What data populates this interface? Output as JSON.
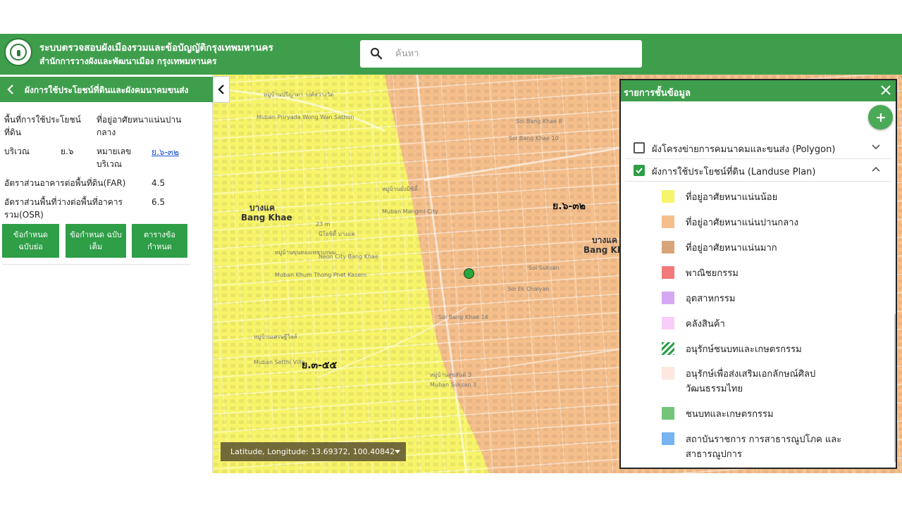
{
  "header": {
    "title": "ระบบตรวจสอบผังเมืองรวมและข้อบัญญัติกรุงเทพมหานคร",
    "subtitle": "สำนักการวางผังและพัฒนาเมือง กรุงเทพมหานคร",
    "search_placeholder": "ค้นหา",
    "search_value": "",
    "brand_color": "#3e9e4c"
  },
  "left_panel": {
    "title": "ผังการใช้ประโยชน์ที่ดินและผังคมนาคมขนส่ง",
    "rows": [
      {
        "label": "พื้นที่การใช้ประโยชน์ที่ดิน",
        "value": "ที่อยู่อาศัยหนาแน่นปานกลาง"
      },
      {
        "label": "บริเวณ",
        "value": "ย.๖",
        "sublabel": "หมายเลขบริเวณ",
        "link": "ย.๖-๓๒"
      },
      {
        "label": "อัตราส่วนอาคารต่อพื้นที่ดิน(FAR)",
        "value": "4.5"
      },
      {
        "label": "อัตราส่วนพื้นที่ว่างต่อพื้นที่อาคารรวม(OSR)",
        "value": "6.5"
      }
    ],
    "buttons": [
      "ข้อกำหนด ฉบับย่อ",
      "ข้อกำหนด ฉบับเต็ม",
      "ตารางข้อ กำหนด"
    ]
  },
  "map": {
    "zone_labels": [
      "ย.๖-๓๒",
      "ย.๓-๕๕"
    ],
    "district_labels": [
      "บางแค",
      "Bang Khae",
      "บางแค",
      "Bang Kh"
    ],
    "place_labels": [
      "หมู่บ้านปรีญาดา วงศ์สว่างวัด",
      "Muban Priryada Wong Wan Sathon",
      "หมู่บ้านมิตรไทย",
      "Mitraphap Si",
      "หมู่บ้านมั่งมีซิตี้",
      "Muban Mangmi City",
      "นีโอซิตี้ บางแค",
      "Neon City Bang Khae",
      "หมู่บ้านขุนทองเพชรเกษม",
      "Muban Khum Thong Phet Kasem",
      "หมู่บ้านเศรษฐีวิลล์",
      "Muban Setthi Ville",
      "หมู่บ้านสุขสันต์ 3",
      "Muban Suksan 3",
      "Soi Bang Khae 10",
      "Soi Bang Khae 8",
      "Soi Bang Khae 14",
      "Soi Ek Chaiyan",
      "Soi Suksan",
      "23 m"
    ],
    "coordinates_text": "Latitude, Longitude: 13.69372, 100.40842",
    "colors": {
      "low_density": "#f7f46a",
      "medium_density": "#f5bf8c",
      "marker": "#27a83b"
    }
  },
  "layers_panel": {
    "title": "รายการชั้นข้อมูล",
    "layers": [
      {
        "label": "ผังโครงข่ายการคมนาคมและขนส่ง (Polygon)",
        "checked": false,
        "expanded": false
      },
      {
        "label": "ผังการใช้ประโยชน์ที่ดิน (Landuse Plan)",
        "checked": true,
        "expanded": true
      }
    ],
    "legend": [
      {
        "label": "ที่อยู่อาศัยหนาแน่นน้อย",
        "color": "#f7f46a"
      },
      {
        "label": "ที่อยู่อาศัยหนาแน่นปานกลาง",
        "color": "#f5bf8c"
      },
      {
        "label": "ที่อยู่อาศัยหนาแน่นมาก",
        "color": "#d8a57b"
      },
      {
        "label": "พาณิชยกรรม",
        "color": "#f27a7a"
      },
      {
        "label": "อุตสาหกรรม",
        "color": "#d6a8f3"
      },
      {
        "label": "คลังสินค้า",
        "color": "#f8cdf8"
      },
      {
        "label": "อนุรักษ์ชนบทและเกษตรกรรม",
        "color": "#2e9e47"
      },
      {
        "label": "อนุรักษ์เพื่อส่งเสริมเอกลักษณ์ศิลปวัฒนธรรมไทย",
        "color": "#fde7de"
      },
      {
        "label": "ชนบทและเกษตรกรรม",
        "color": "#74c47a"
      },
      {
        "label": "สถาบันราชการ การสาธารณูปโภค และสาธารณูปการ",
        "color": "#77b3f1"
      }
    ]
  }
}
